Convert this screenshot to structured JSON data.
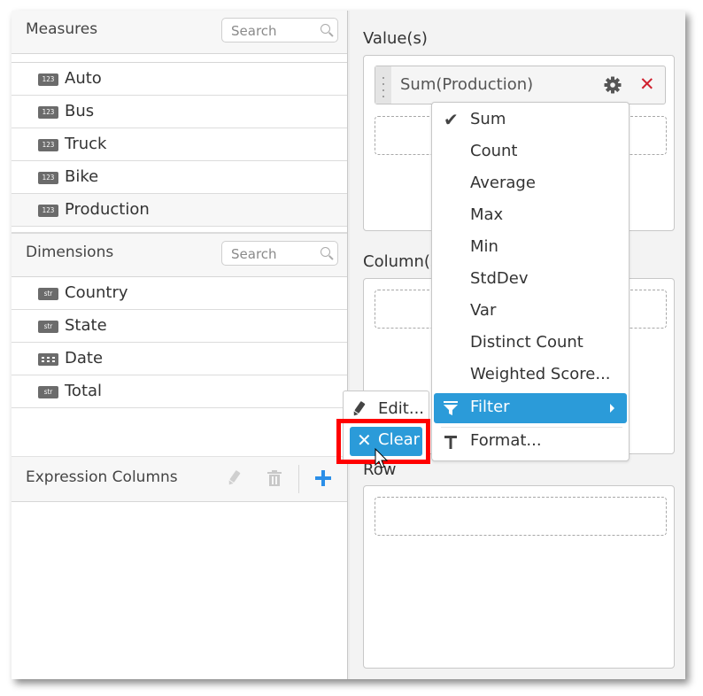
{
  "measures": {
    "title": "Measures",
    "search_placeholder": "Search",
    "items": [
      {
        "type_badge": "123",
        "label": "Auto"
      },
      {
        "type_badge": "123",
        "label": "Bus"
      },
      {
        "type_badge": "123",
        "label": "Truck"
      },
      {
        "type_badge": "123",
        "label": "Bike"
      },
      {
        "type_badge": "123",
        "label": "Production"
      }
    ]
  },
  "dimensions": {
    "title": "Dimensions",
    "search_placeholder": "Search",
    "items": [
      {
        "type_badge": "str",
        "label": "Country"
      },
      {
        "type_badge": "str",
        "label": "State"
      },
      {
        "type_badge": "calendar",
        "label": "Date"
      },
      {
        "type_badge": "str",
        "label": "Total"
      }
    ]
  },
  "expression_columns": {
    "title": "Expression Columns",
    "icons": [
      "pencil-icon",
      "trash-icon",
      "plus-icon"
    ]
  },
  "values_section": {
    "label": "Value(s)",
    "pill_label": "Sum(Production)",
    "pill_icons": [
      "gear-icon",
      "close-icon"
    ],
    "close_glyph": "✕"
  },
  "columns_section": {
    "label": "Column(s)"
  },
  "rows_section": {
    "label": "Row"
  },
  "aggregate_menu": {
    "items": [
      {
        "label": "Sum",
        "checked": true
      },
      {
        "label": "Count"
      },
      {
        "label": "Average"
      },
      {
        "label": "Max"
      },
      {
        "label": "Min"
      },
      {
        "label": "StdDev"
      },
      {
        "label": "Var"
      },
      {
        "label": "Distinct Count"
      },
      {
        "label": "Weighted Score..."
      },
      {
        "label": "Filter",
        "icon": "filter-icon",
        "has_submenu": true,
        "active": true
      },
      {
        "label": "Format...",
        "icon": "text-format-icon"
      }
    ],
    "check_glyph": "✔"
  },
  "filter_submenu": {
    "items": [
      {
        "label": "Edit...",
        "icon": "pencil-icon"
      },
      {
        "label": "Clear",
        "icon": "close-icon",
        "active": true
      }
    ],
    "clear_glyph": "✕"
  },
  "colors": {
    "accent": "#2b9bd9",
    "highlight_border": "#ff0000",
    "remove": "#d0202e",
    "panel_bg": "#f3f3f3"
  }
}
